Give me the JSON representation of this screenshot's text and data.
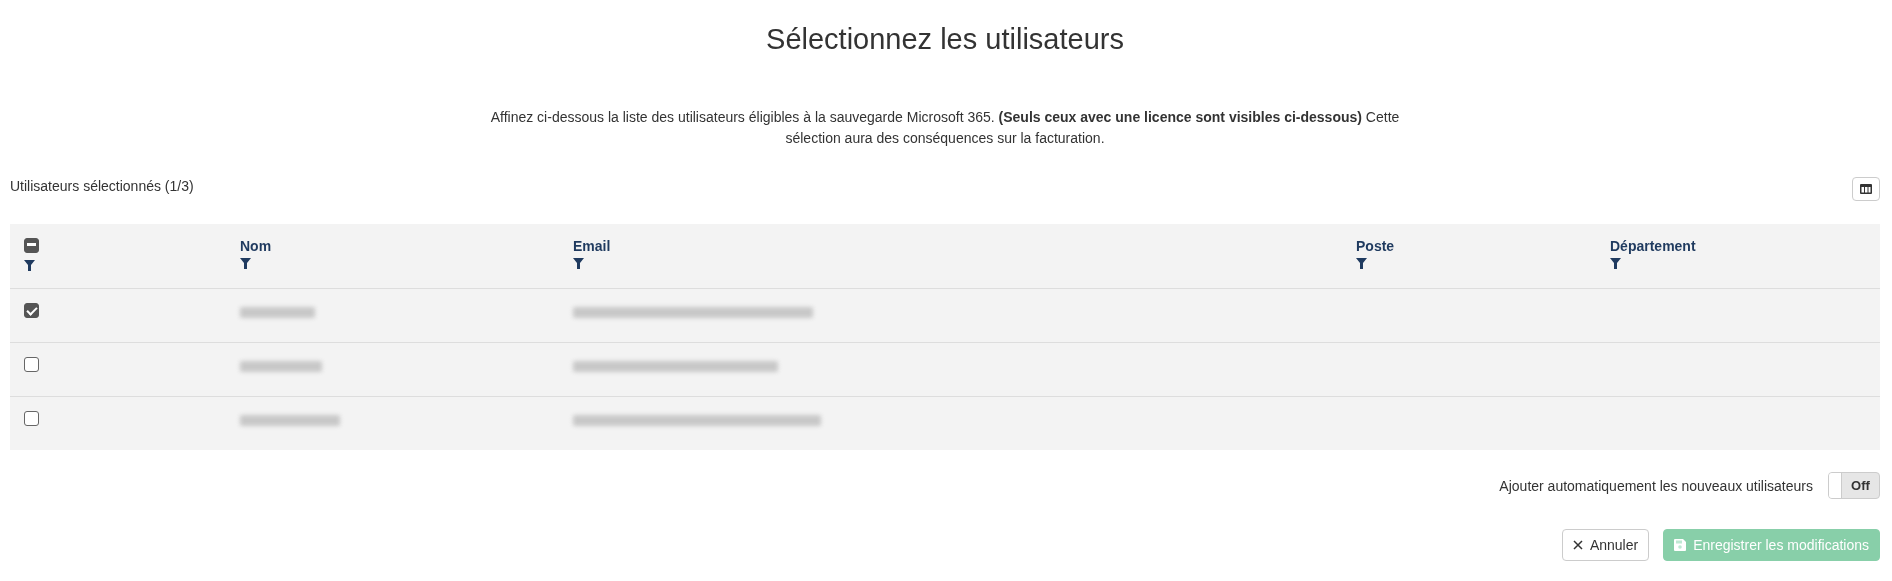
{
  "title": "Sélectionnez les utilisateurs",
  "description": "Affinez ci-dessous la liste des utilisateurs éligibles à la sauvegarde Microsoft 365. **(Seuls ceux avec une licence sont visibles ci-dessous)** Cette sélection aura des conséquences sur la facturation.",
  "selection_count": "Utilisateurs sélectionnés (1/3)",
  "table": {
    "select_all": {
      "indeterminate": true
    },
    "columns": [
      "Nom",
      "Email",
      "Poste",
      "Département"
    ],
    "rows": [
      {
        "checked": true
      },
      {
        "checked": false
      },
      {
        "checked": false
      }
    ]
  },
  "auto_add": {
    "label": "Ajouter automatiquement les nouveaux utilisateurs",
    "on": false,
    "state_label": "Off"
  },
  "buttons": [
    {
      "kind": "cancel",
      "label": "Annuler",
      "disabled": false
    },
    {
      "kind": "save",
      "label": "Enregistrer les modifications",
      "disabled": true
    }
  ]
}
